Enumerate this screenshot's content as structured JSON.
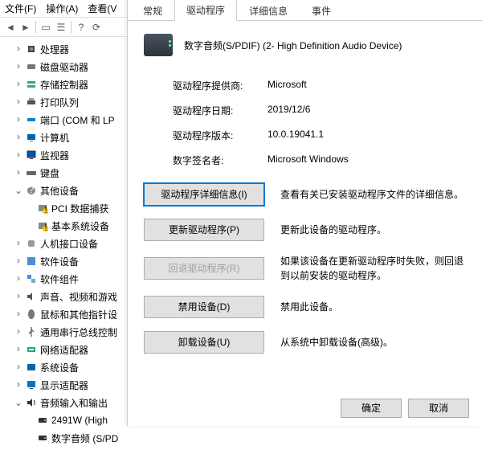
{
  "menu": {
    "file": "文件(F)",
    "action": "操作(A)",
    "view": "查看(V"
  },
  "tree": [
    {
      "toggle": ">",
      "icon": "cpu",
      "label": "处理器",
      "indent": 1
    },
    {
      "toggle": ">",
      "icon": "disk",
      "label": "磁盘驱动器",
      "indent": 1
    },
    {
      "toggle": ">",
      "icon": "storage",
      "label": "存储控制器",
      "indent": 1
    },
    {
      "toggle": ">",
      "icon": "printer",
      "label": "打印队列",
      "indent": 1
    },
    {
      "toggle": ">",
      "icon": "port",
      "label": "端口 (COM 和 LP",
      "indent": 1
    },
    {
      "toggle": ">",
      "icon": "computer",
      "label": "计算机",
      "indent": 1
    },
    {
      "toggle": ">",
      "icon": "monitor",
      "label": "监视器",
      "indent": 1
    },
    {
      "toggle": ">",
      "icon": "keyboard",
      "label": "键盘",
      "indent": 1
    },
    {
      "toggle": "v",
      "icon": "other",
      "label": "其他设备",
      "indent": 1
    },
    {
      "toggle": "",
      "icon": "warn",
      "label": "PCI 数据捕获",
      "indent": 2
    },
    {
      "toggle": "",
      "icon": "warn",
      "label": "基本系统设备",
      "indent": 2
    },
    {
      "toggle": ">",
      "icon": "hid",
      "label": "人机接口设备",
      "indent": 1
    },
    {
      "toggle": ">",
      "icon": "sw",
      "label": "软件设备",
      "indent": 1
    },
    {
      "toggle": ">",
      "icon": "swc",
      "label": "软件组件",
      "indent": 1
    },
    {
      "toggle": ">",
      "icon": "audio",
      "label": "声音、视频和游戏",
      "indent": 1
    },
    {
      "toggle": ">",
      "icon": "mouse",
      "label": "鼠标和其他指针设",
      "indent": 1
    },
    {
      "toggle": ">",
      "icon": "usb",
      "label": "通用串行总线控制",
      "indent": 1
    },
    {
      "toggle": ">",
      "icon": "net",
      "label": "网络适配器",
      "indent": 1
    },
    {
      "toggle": ">",
      "icon": "system",
      "label": "系统设备",
      "indent": 1
    },
    {
      "toggle": ">",
      "icon": "display",
      "label": "显示适配器",
      "indent": 1
    },
    {
      "toggle": "v",
      "icon": "audioout",
      "label": "音频输入和输出",
      "indent": 1
    },
    {
      "toggle": "",
      "icon": "speaker",
      "label": "2491W (High",
      "indent": 2
    },
    {
      "toggle": "",
      "icon": "speaker",
      "label": "数字音频 (S/PD",
      "indent": 2
    }
  ],
  "tabs": {
    "general": "常规",
    "driver": "驱动程序",
    "details": "详细信息",
    "events": "事件"
  },
  "device": {
    "title": "数字音频(S/PDIF) (2- High Definition Audio Device)"
  },
  "info": {
    "provider_label": "驱动程序提供商:",
    "provider_value": "Microsoft",
    "date_label": "驱动程序日期:",
    "date_value": "2019/12/6",
    "version_label": "驱动程序版本:",
    "version_value": "10.0.19041.1",
    "signer_label": "数字签名者:",
    "signer_value": "Microsoft Windows"
  },
  "actions": {
    "details_btn": "驱动程序详细信息(I)",
    "details_desc": "查看有关已安装驱动程序文件的详细信息。",
    "update_btn": "更新驱动程序(P)",
    "update_desc": "更新此设备的驱动程序。",
    "rollback_btn": "回退驱动程序(R)",
    "rollback_desc": "如果该设备在更新驱动程序时失败，则回退到以前安装的驱动程序。",
    "disable_btn": "禁用设备(D)",
    "disable_desc": "禁用此设备。",
    "uninstall_btn": "卸载设备(U)",
    "uninstall_desc": "从系统中卸载设备(高级)。"
  },
  "buttons": {
    "ok": "确定",
    "cancel": "取消"
  }
}
